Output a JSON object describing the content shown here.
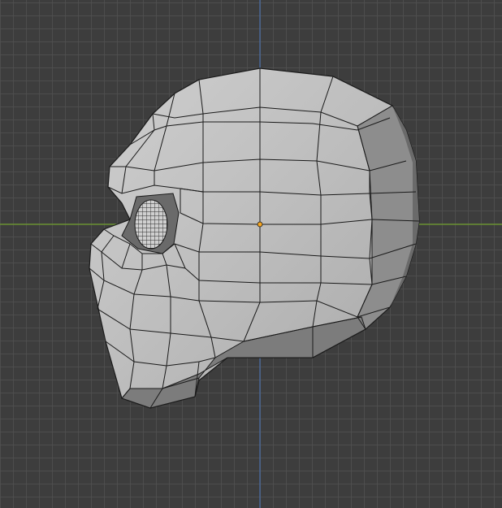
{
  "viewport": {
    "view": "side-orthographic",
    "background_color": "#3d3d3d",
    "grid_line_color": "#505050",
    "x_axis_color": "#6f9e2c",
    "z_axis_color": "#4a6fa8",
    "origin_color": "#f5a623"
  },
  "object": {
    "type": "mesh",
    "shading": "solid-wireframe",
    "part": "head",
    "face_color": "#bcbcbc",
    "edge_color": "#1a1a1a"
  }
}
